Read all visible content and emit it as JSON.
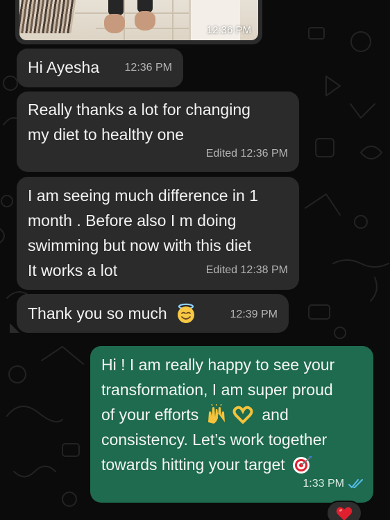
{
  "chat": {
    "image_message": {
      "time": "12:36 PM"
    },
    "messages": [
      {
        "text": "Hi Ayesha",
        "time": "12:36 PM"
      },
      {
        "lines": [
          "Really thanks a lot for changing",
          "my diet to healthy one"
        ],
        "edited": "Edited",
        "time": "12:36 PM"
      },
      {
        "lines": [
          "I am seeing  much difference in 1",
          "month . Before also I m doing",
          "swimming but now with this diet",
          "It works a lot"
        ],
        "edited": "Edited",
        "time": "12:38 PM"
      },
      {
        "text": "Thank you so much",
        "emoji": "smiling-face-with-halo",
        "time": "12:39 PM"
      }
    ],
    "reply": {
      "line1": "Hi ! I am really happy to see your",
      "line2": "transformation, I am super proud",
      "line3_pre": "of your efforts",
      "line3_emojis": [
        "raising-hands",
        "heart-hands"
      ],
      "line3_post": "and",
      "line4": "consistency. Let’s work together",
      "line5": "towards hitting your target",
      "line5_emoji": "direct-hit",
      "time": "1:33 PM",
      "status_icon": "double-check-read-icon",
      "reaction": "red-heart"
    }
  },
  "colors": {
    "background": "#0b0b0b",
    "incoming_bubble": "#2b2b2b",
    "outgoing_bubble": "#1e6b4f",
    "read_ticks": "#53bdeb",
    "heart": "#e0202e"
  }
}
